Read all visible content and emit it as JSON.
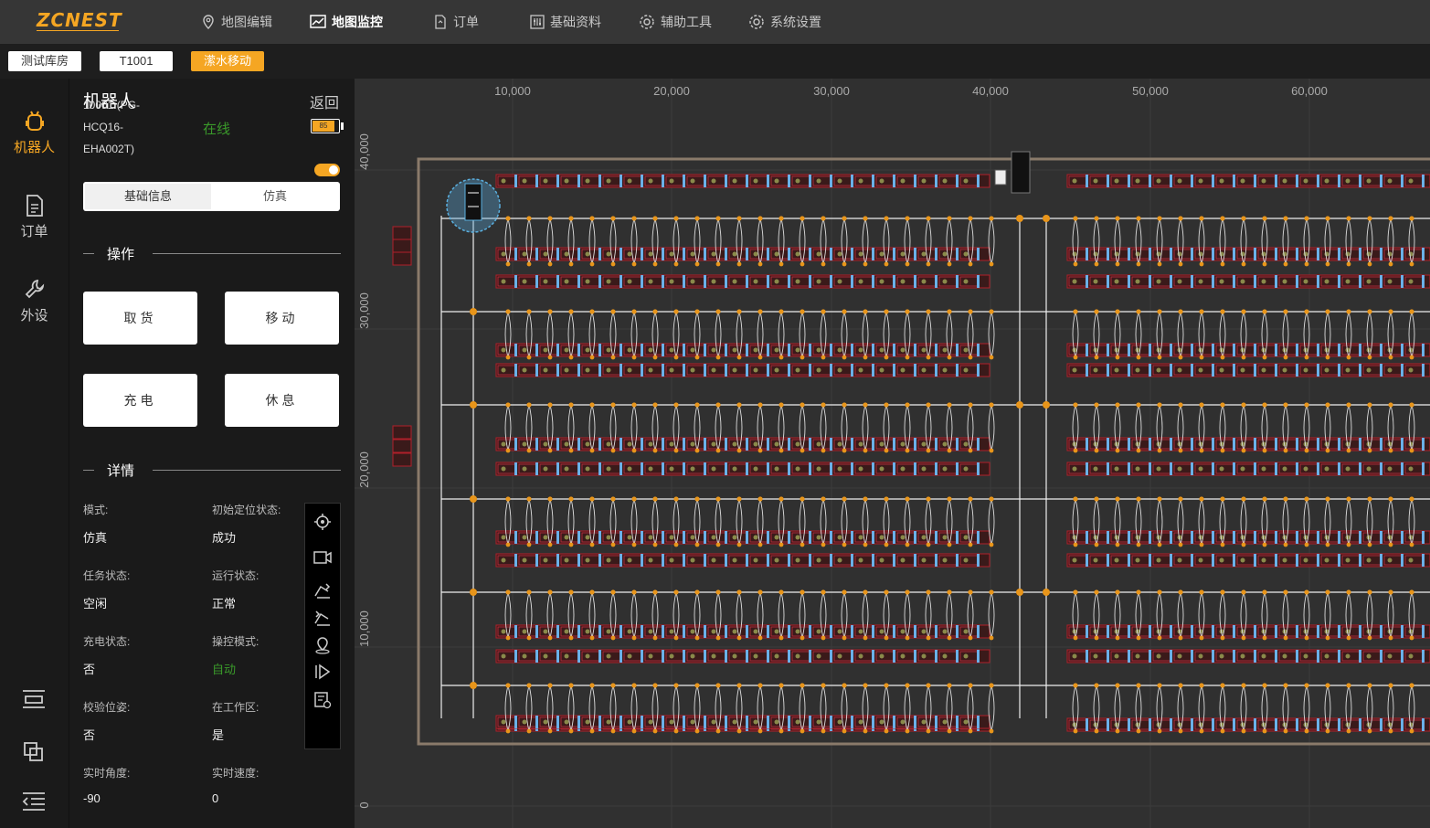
{
  "app": {
    "logo": "ZCNEST",
    "accent": "#f5a623"
  },
  "nav": [
    {
      "label": "地图编辑",
      "icon": "location-pin-icon"
    },
    {
      "label": "地图监控",
      "icon": "monitor-chart-icon",
      "active": true
    },
    {
      "label": "订单",
      "icon": "document-icon"
    },
    {
      "label": "基础资料",
      "icon": "sliders-icon"
    },
    {
      "label": "辅助工具",
      "icon": "gear-icon"
    },
    {
      "label": "系统设置",
      "icon": "gear-icon"
    }
  ],
  "subbar": {
    "warehouse": "测试库房",
    "robot_id": "T1001",
    "status_tag": "潆水移动"
  },
  "leftnav": [
    {
      "label": "机器人",
      "icon": "robot-icon",
      "active": true
    },
    {
      "label": "订单",
      "icon": "document-icon"
    },
    {
      "label": "外设",
      "icon": "wrench-icon"
    }
  ],
  "leftnav_bottom_icons": [
    "list-icon",
    "copy-icon",
    "collapse-menu-icon"
  ],
  "robot_panel": {
    "title": "机器人",
    "back": "返回",
    "robot_name_line1": "10001 (PG-",
    "robot_name_line2": "HCQ16-",
    "robot_name_line3": "EHA002T)",
    "online": "在线",
    "battery": "85",
    "tabs": [
      "基础信息",
      "仿真"
    ],
    "ops_title": "操作",
    "buttons": [
      "取货",
      "移动",
      "充电",
      "休息"
    ],
    "details_title": "详情",
    "details": [
      {
        "label": "模式:",
        "value": "仿真"
      },
      {
        "label": "初始定位状态:",
        "value": "成功"
      },
      {
        "label": "任务状态:",
        "value": "空闲"
      },
      {
        "label": "运行状态:",
        "value": "正常"
      },
      {
        "label": "充电状态:",
        "value": "否"
      },
      {
        "label": "操控模式:",
        "value": "自动"
      },
      {
        "label": "校验位姿:",
        "value": "否"
      },
      {
        "label": "在工作区:",
        "value": "是"
      },
      {
        "label": "实时角度:",
        "value": "-90"
      },
      {
        "label": "实时速度:",
        "value": "0"
      }
    ]
  },
  "map_tools": [
    "locate-icon",
    "camera-icon",
    "forklift-up-icon",
    "forklift-down-icon",
    "map-pin-icon",
    "play-icon",
    "record-icon"
  ],
  "map": {
    "x_ticks": [
      "10,000",
      "20,000",
      "30,000",
      "40,000",
      "50,000",
      "60,000"
    ],
    "y_ticks": [
      "40,000",
      "30,000",
      "20,000",
      "10,000",
      "0"
    ]
  }
}
